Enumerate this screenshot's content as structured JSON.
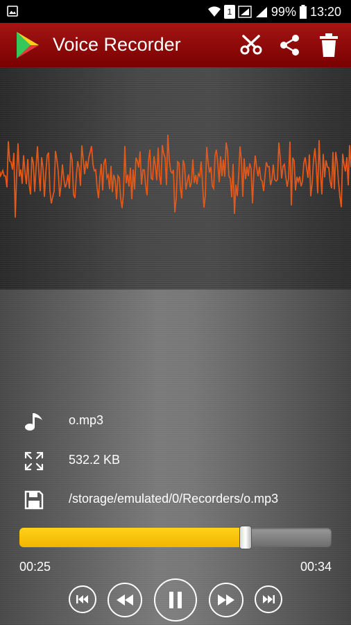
{
  "status_bar": {
    "sim_label": "1",
    "battery": "99%",
    "time": "13:20"
  },
  "app_bar": {
    "title": "Voice Recorder",
    "actions": [
      "scissors-icon",
      "share-icon",
      "trash-icon"
    ]
  },
  "file_info": {
    "name": "o.mp3",
    "size": "532.2 KB",
    "path": "/storage/emulated/0/Recorders/o.mp3"
  },
  "player": {
    "elapsed": "00:25",
    "total": "00:34",
    "progress": 0.725,
    "buttons": [
      "skip-previous-icon",
      "rewind-icon",
      "pause-icon",
      "fast-forward-icon",
      "skip-next-icon"
    ]
  },
  "colors": {
    "app_bar": "#8b0000",
    "waveform": "#e0581a",
    "seek_fill": "#f7c300"
  }
}
